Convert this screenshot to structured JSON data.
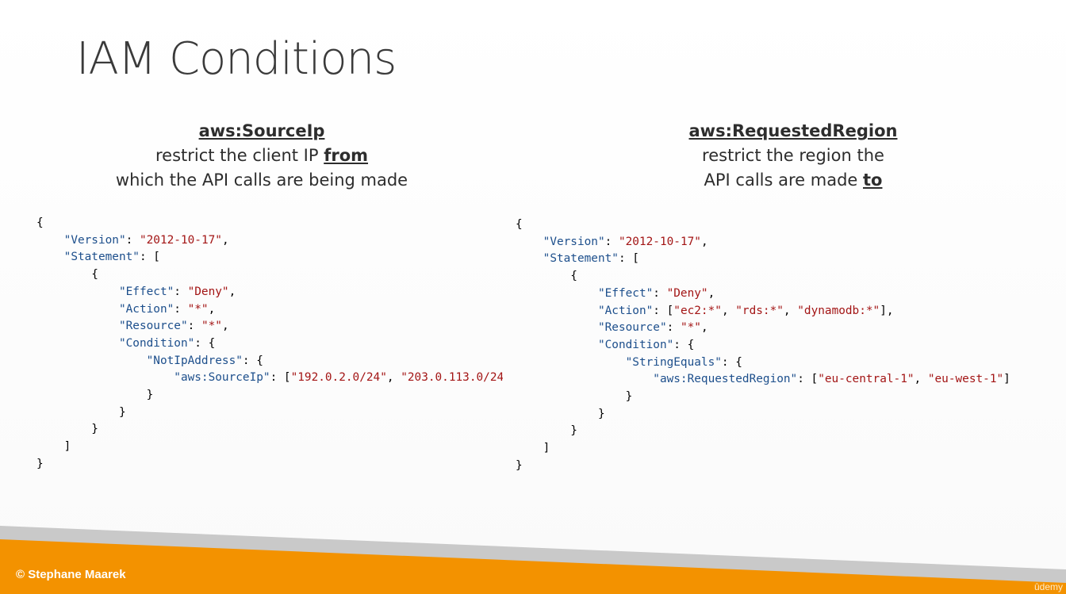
{
  "slide": {
    "title": "IAM Conditions",
    "footer": "© Stephane Maarek",
    "watermark": "ûdemy",
    "colors": {
      "orange": "#f39200",
      "grey": "#c9c9c9",
      "json_key": "#1d4f8c",
      "json_string": "#a31515"
    }
  },
  "left": {
    "heading": "aws:SourceIp",
    "desc_pre": "restrict the client IP ",
    "desc_em": "from",
    "desc_line2": "which the API calls are being made",
    "code_lines": [
      [
        {
          "t": "{"
        }
      ],
      [
        {
          "t": "    "
        },
        {
          "t": "\"Version\"",
          "c": "k"
        },
        {
          "t": ": "
        },
        {
          "t": "\"2012-10-17\"",
          "c": "s"
        },
        {
          "t": ","
        }
      ],
      [
        {
          "t": "    "
        },
        {
          "t": "\"Statement\"",
          "c": "k"
        },
        {
          "t": ": ["
        }
      ],
      [
        {
          "t": "        {"
        }
      ],
      [
        {
          "t": "            "
        },
        {
          "t": "\"Effect\"",
          "c": "k"
        },
        {
          "t": ": "
        },
        {
          "t": "\"Deny\"",
          "c": "s"
        },
        {
          "t": ","
        }
      ],
      [
        {
          "t": "            "
        },
        {
          "t": "\"Action\"",
          "c": "k"
        },
        {
          "t": ": "
        },
        {
          "t": "\"*\"",
          "c": "s"
        },
        {
          "t": ","
        }
      ],
      [
        {
          "t": "            "
        },
        {
          "t": "\"Resource\"",
          "c": "k"
        },
        {
          "t": ": "
        },
        {
          "t": "\"*\"",
          "c": "s"
        },
        {
          "t": ","
        }
      ],
      [
        {
          "t": "            "
        },
        {
          "t": "\"Condition\"",
          "c": "k"
        },
        {
          "t": ": {"
        }
      ],
      [
        {
          "t": "                "
        },
        {
          "t": "\"NotIpAddress\"",
          "c": "k"
        },
        {
          "t": ": {"
        }
      ],
      [
        {
          "t": "                    "
        },
        {
          "t": "\"aws:SourceIp\"",
          "c": "k"
        },
        {
          "t": ": ["
        },
        {
          "t": "\"192.0.2.0/24\"",
          "c": "s"
        },
        {
          "t": ", "
        },
        {
          "t": "\"203.0.113.0/24",
          "c": "s"
        }
      ],
      [
        {
          "t": "                }"
        }
      ],
      [
        {
          "t": "            }"
        }
      ],
      [
        {
          "t": "        }"
        }
      ],
      [
        {
          "t": "    ]"
        }
      ],
      [
        {
          "t": "}"
        }
      ]
    ]
  },
  "right": {
    "heading": "aws:RequestedRegion",
    "desc_line1": "restrict the region the",
    "desc_pre": "API calls are made ",
    "desc_em": "to",
    "code_lines": [
      [
        {
          "t": "{"
        }
      ],
      [
        {
          "t": "    "
        },
        {
          "t": "\"Version\"",
          "c": "k"
        },
        {
          "t": ": "
        },
        {
          "t": "\"2012-10-17\"",
          "c": "s"
        },
        {
          "t": ","
        }
      ],
      [
        {
          "t": "    "
        },
        {
          "t": "\"Statement\"",
          "c": "k"
        },
        {
          "t": ": ["
        }
      ],
      [
        {
          "t": "        {"
        }
      ],
      [
        {
          "t": "            "
        },
        {
          "t": "\"Effect\"",
          "c": "k"
        },
        {
          "t": ": "
        },
        {
          "t": "\"Deny\"",
          "c": "s"
        },
        {
          "t": ","
        }
      ],
      [
        {
          "t": "            "
        },
        {
          "t": "\"Action\"",
          "c": "k"
        },
        {
          "t": ": ["
        },
        {
          "t": "\"ec2:*\"",
          "c": "s"
        },
        {
          "t": ", "
        },
        {
          "t": "\"rds:*\"",
          "c": "s"
        },
        {
          "t": ", "
        },
        {
          "t": "\"dynamodb:*\"",
          "c": "s"
        },
        {
          "t": "],"
        }
      ],
      [
        {
          "t": "            "
        },
        {
          "t": "\"Resource\"",
          "c": "k"
        },
        {
          "t": ": "
        },
        {
          "t": "\"*\"",
          "c": "s"
        },
        {
          "t": ","
        }
      ],
      [
        {
          "t": "            "
        },
        {
          "t": "\"Condition\"",
          "c": "k"
        },
        {
          "t": ": {"
        }
      ],
      [
        {
          "t": "                "
        },
        {
          "t": "\"StringEquals\"",
          "c": "k"
        },
        {
          "t": ": {"
        }
      ],
      [
        {
          "t": "                    "
        },
        {
          "t": "\"aws:RequestedRegion\"",
          "c": "k"
        },
        {
          "t": ": ["
        },
        {
          "t": "\"eu-central-1\"",
          "c": "s"
        },
        {
          "t": ", "
        },
        {
          "t": "\"eu-west-1\"",
          "c": "s"
        },
        {
          "t": "]"
        }
      ],
      [
        {
          "t": "                }"
        }
      ],
      [
        {
          "t": "            }"
        }
      ],
      [
        {
          "t": "        }"
        }
      ],
      [
        {
          "t": "    ]"
        }
      ],
      [
        {
          "t": "}"
        }
      ]
    ]
  }
}
